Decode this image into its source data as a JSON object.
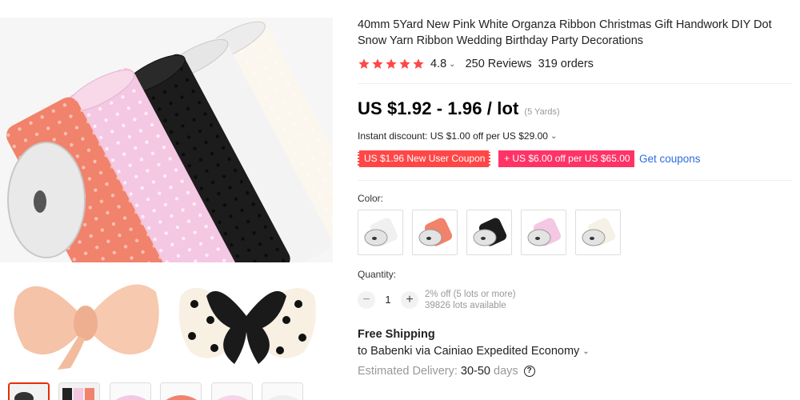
{
  "product": {
    "title": "40mm 5Yard New Pink White Organza Ribbon Christmas Gift Handwork DIY Dot Snow Yarn Ribbon Wedding Birthday Party Decorations",
    "rating": "4.8",
    "reviews": "250 Reviews",
    "orders": "319 orders",
    "stars_count": 5,
    "star_color": "#ff4747"
  },
  "price": {
    "range": "US $1.92 - 1.96 / lot",
    "unit_note": "(5 Yards)"
  },
  "discount": {
    "instant": "Instant discount: US $1.00 off per US $29.00",
    "coupon_user": "US $1.96 New User Coupon",
    "coupon_store": "+ US $6.00 off per US $65.00",
    "get_coupons": "Get coupons"
  },
  "options": {
    "color_label": "Color:",
    "swatches": [
      "white-gray",
      "coral",
      "black",
      "pink",
      "ivory"
    ]
  },
  "quantity": {
    "label": "Quantity:",
    "value": "1",
    "minus": "−",
    "plus": "+",
    "bulk_discount": "2% off (5 lots or more)",
    "available": "39826 lots available"
  },
  "shipping": {
    "title": "Free Shipping",
    "route": "to Babenki via Cainiao Expedited Economy",
    "delivery_label": "Estimated Delivery:",
    "delivery_days": "30-50",
    "delivery_unit": "days",
    "help": "?"
  },
  "icons": {
    "chevron": "⌄"
  },
  "colors": {
    "accent_red": "#ff4747",
    "coupon_pink": "#ff3366",
    "link_blue": "#2e6ae0"
  }
}
